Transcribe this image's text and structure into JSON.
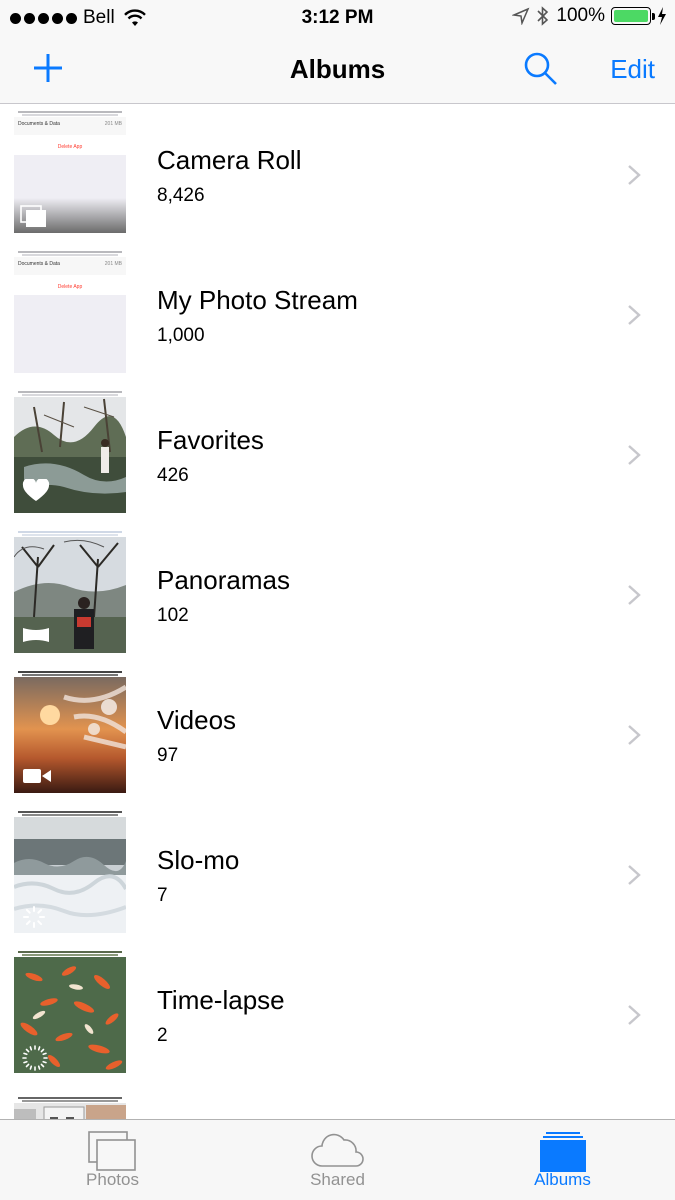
{
  "status_bar": {
    "carrier": "Bell",
    "time": "3:12 PM",
    "battery": "100%"
  },
  "nav": {
    "title": "Albums",
    "edit_label": "Edit"
  },
  "thumb_text": {
    "documents_label": "Documents & Data",
    "size_label": "201 MB",
    "delete_label": "Delete App"
  },
  "albums": [
    {
      "title": "Camera Roll",
      "count": "8,426",
      "icon": "camera-roll-badge-icon"
    },
    {
      "title": "My Photo Stream",
      "count": "1,000",
      "icon": ""
    },
    {
      "title": "Favorites",
      "count": "426",
      "icon": "heart-icon"
    },
    {
      "title": "Panoramas",
      "count": "102",
      "icon": "panorama-icon"
    },
    {
      "title": "Videos",
      "count": "97",
      "icon": "video-camera-icon"
    },
    {
      "title": "Slo-mo",
      "count": "7",
      "icon": "slomo-icon"
    },
    {
      "title": "Time-lapse",
      "count": "2",
      "icon": "timelapse-icon"
    }
  ],
  "tabs": [
    {
      "label": "Photos",
      "icon": "photos-tab-icon",
      "active": false
    },
    {
      "label": "Shared",
      "icon": "cloud-icon",
      "active": false
    },
    {
      "label": "Albums",
      "icon": "albums-tab-icon",
      "active": true
    }
  ],
  "colors": {
    "accent": "#0a7aff",
    "battery": "#4cd964",
    "bar_background": "#f8f8f8",
    "separator": "#c8c7cc"
  }
}
